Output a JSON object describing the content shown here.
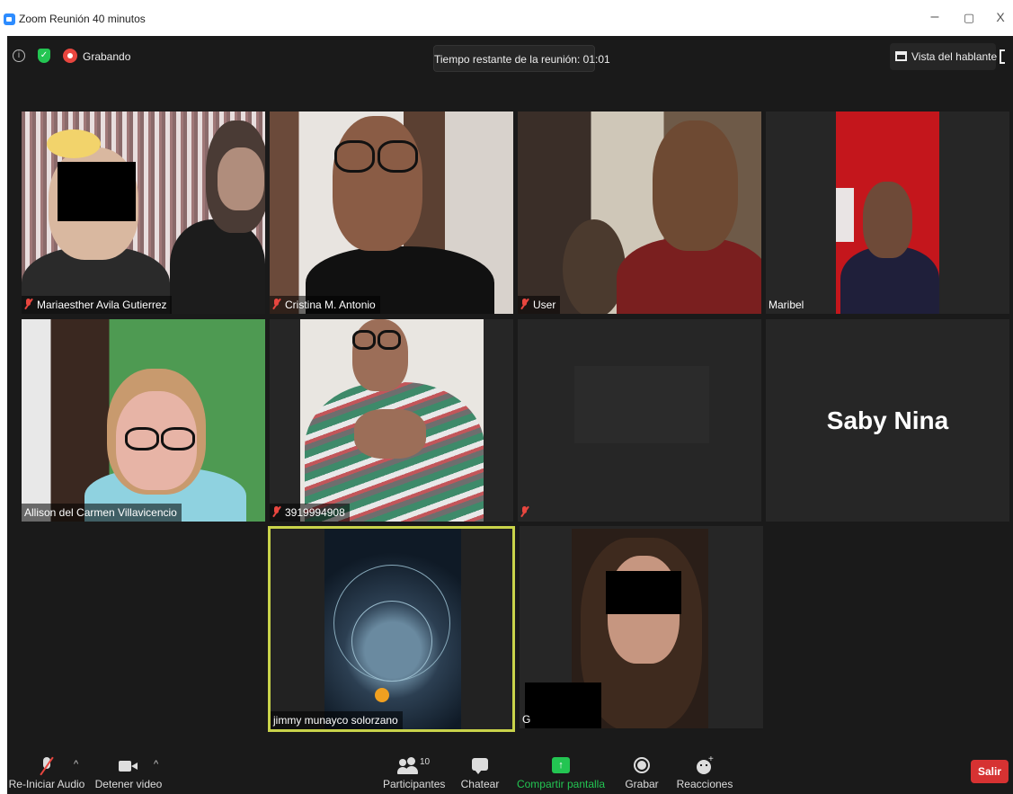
{
  "window": {
    "title": "Zoom Reunión 40 minutos",
    "controls": {
      "minimize": "–",
      "maximize": "▢",
      "close": "X"
    }
  },
  "topbar": {
    "info_icon": "i",
    "recording_label": "Grabando",
    "timer": "Tiempo restante de la reunión: 01:01",
    "view_label": "Vista del hablante"
  },
  "participants": [
    {
      "name": "Mariaesther Avila Gutierrez",
      "muted": true
    },
    {
      "name": "Cristina M. Antonio",
      "muted": true
    },
    {
      "name": "User",
      "muted": true
    },
    {
      "name": "Maribel",
      "muted": false
    },
    {
      "name": "Allison del Carmen Villavicencio",
      "muted": false
    },
    {
      "name": "3919994908",
      "muted": true
    },
    {
      "name": "",
      "muted": true
    },
    {
      "name": "Saby Nina",
      "muted": false,
      "video_off": true
    },
    {
      "name": "jimmy munayco solorzano",
      "muted": false,
      "active_speaker": true
    },
    {
      "name": "G",
      "muted": false
    }
  ],
  "toolbar": {
    "audio_label": "Re-Iniciar Audio",
    "video_label": "Detener video",
    "participants_label": "Participantes",
    "participants_count": "10",
    "chat_label": "Chatear",
    "share_label": "Compartir pantalla",
    "record_label": "Grabar",
    "reactions_label": "Reacciones",
    "leave_label": "Salir",
    "caret": "^"
  },
  "colors": {
    "background": "#1a1a1a",
    "tile": "#262626",
    "active_speaker_border": "#c9d34a",
    "share_green": "#23c552",
    "leave_red": "#d63232",
    "recording_red": "#e8463f"
  }
}
